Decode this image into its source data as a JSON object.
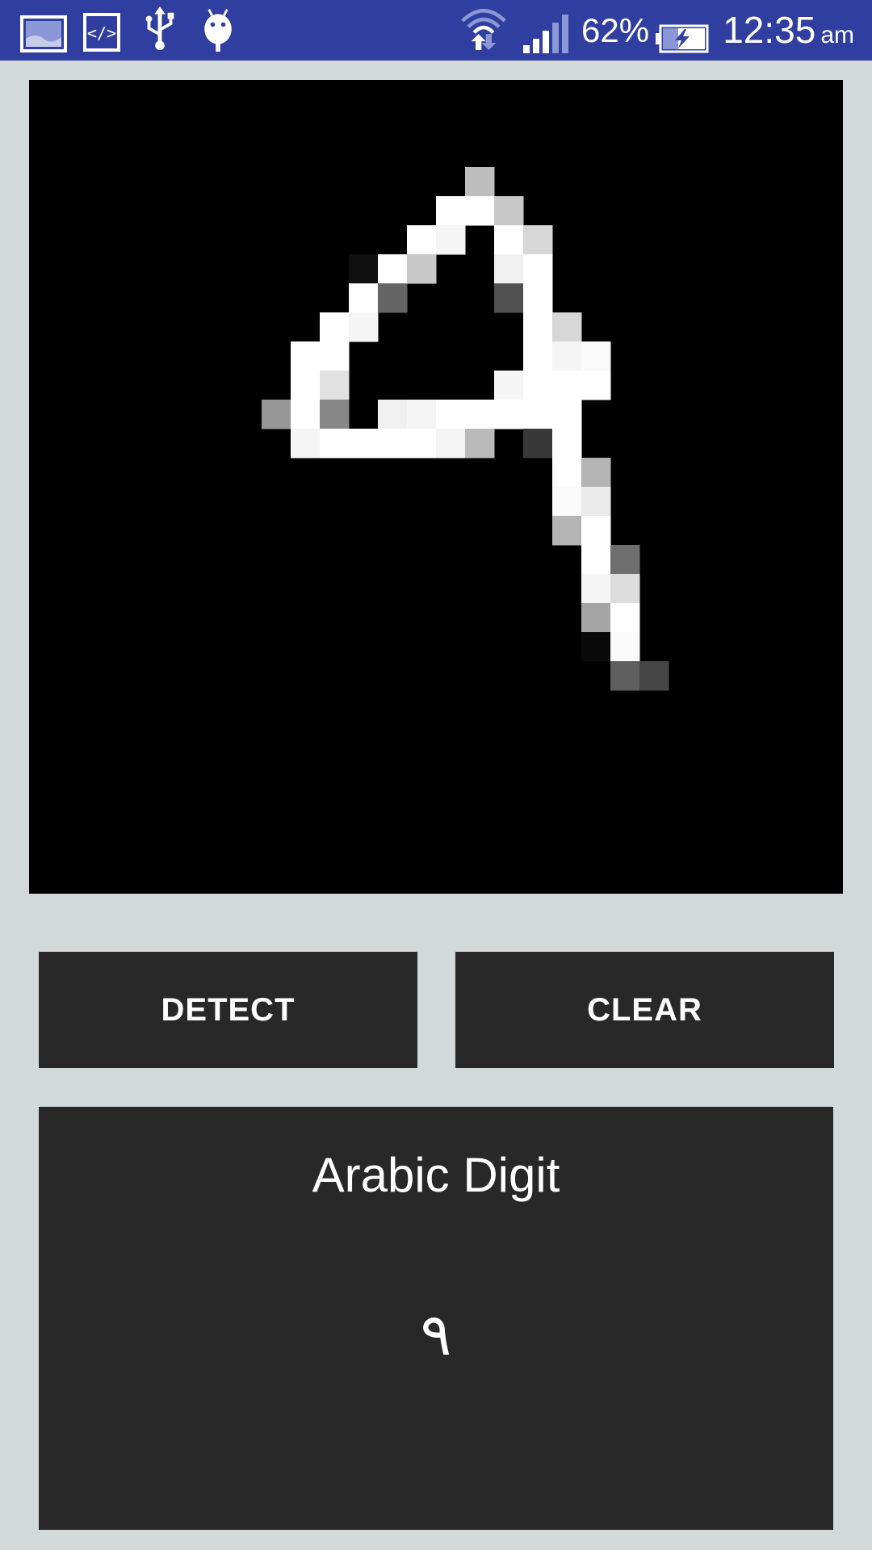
{
  "status_bar": {
    "icons": [
      "gallery-icon",
      "code-icon",
      "usb-icon",
      "android-debug-icon",
      "wifi-icon",
      "signal-icon",
      "battery-charging-icon"
    ],
    "battery": "62%",
    "time": "12:35",
    "ampm": "am"
  },
  "canvas": {
    "description_icon": "handwriting-canvas",
    "grid_size": 28,
    "ink_color": "#ffffff",
    "background_color": "#000000"
  },
  "buttons": {
    "detect_label": "DETECT",
    "clear_label": "CLEAR"
  },
  "result": {
    "title": "Arabic Digit",
    "value": "٩"
  },
  "colors": {
    "status_bar": "#303f9f",
    "page_background": "#d3d8d8",
    "panel": "#282828",
    "text": "#ffffff"
  }
}
